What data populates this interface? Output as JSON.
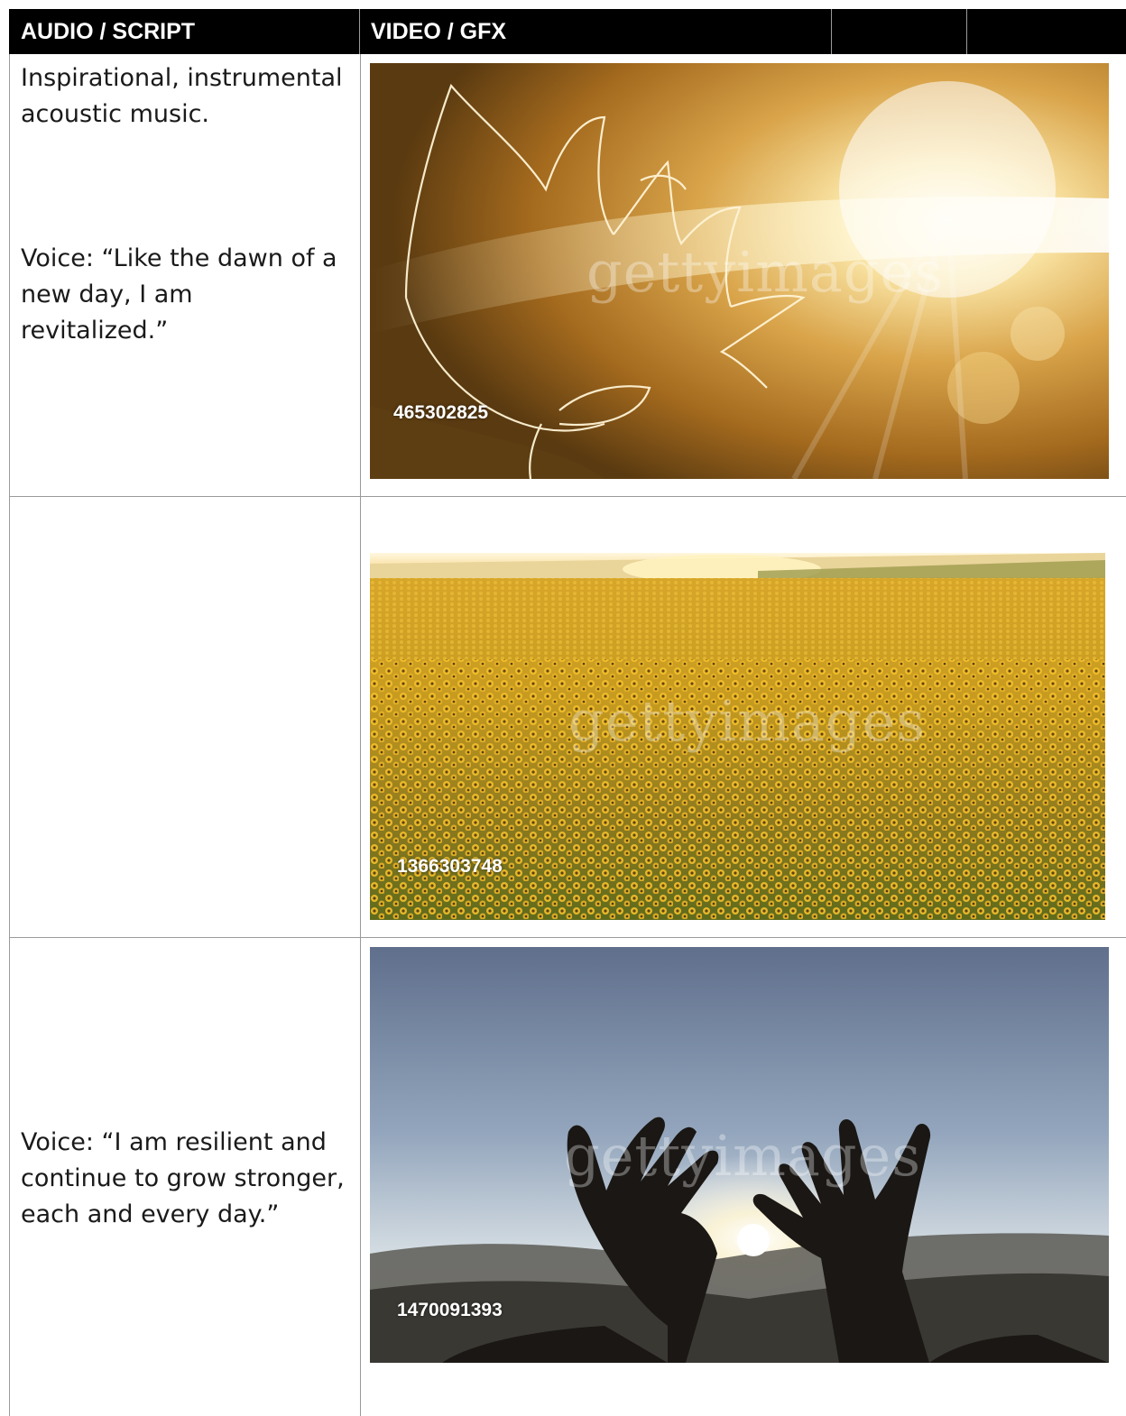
{
  "header": {
    "col_audio": "AUDIO / SCRIPT",
    "col_video": "VIDEO / GFX",
    "col_3": "",
    "col_4": ""
  },
  "rows": [
    {
      "script_line_1": "Inspirational, instrumental acoustic music.",
      "script_line_2": "Voice: “Like the dawn of a new day, I am revitalized.”",
      "image": {
        "subject": "backlit-sunflower",
        "watermark": "gettyimages",
        "clip_id": "465302825"
      }
    },
    {
      "script_line_1": "",
      "script_line_2": "",
      "image": {
        "subject": "sunflower-field-at-sunrise",
        "watermark": "gettyimages",
        "clip_id": "1366303748"
      }
    },
    {
      "script_line_1": "Voice: “I am resilient and continue to grow stronger, each and every day.”",
      "script_line_2": "",
      "image": {
        "subject": "hands-framing-sun",
        "watermark": "gettyimages",
        "clip_id": "1470091393"
      }
    }
  ]
}
